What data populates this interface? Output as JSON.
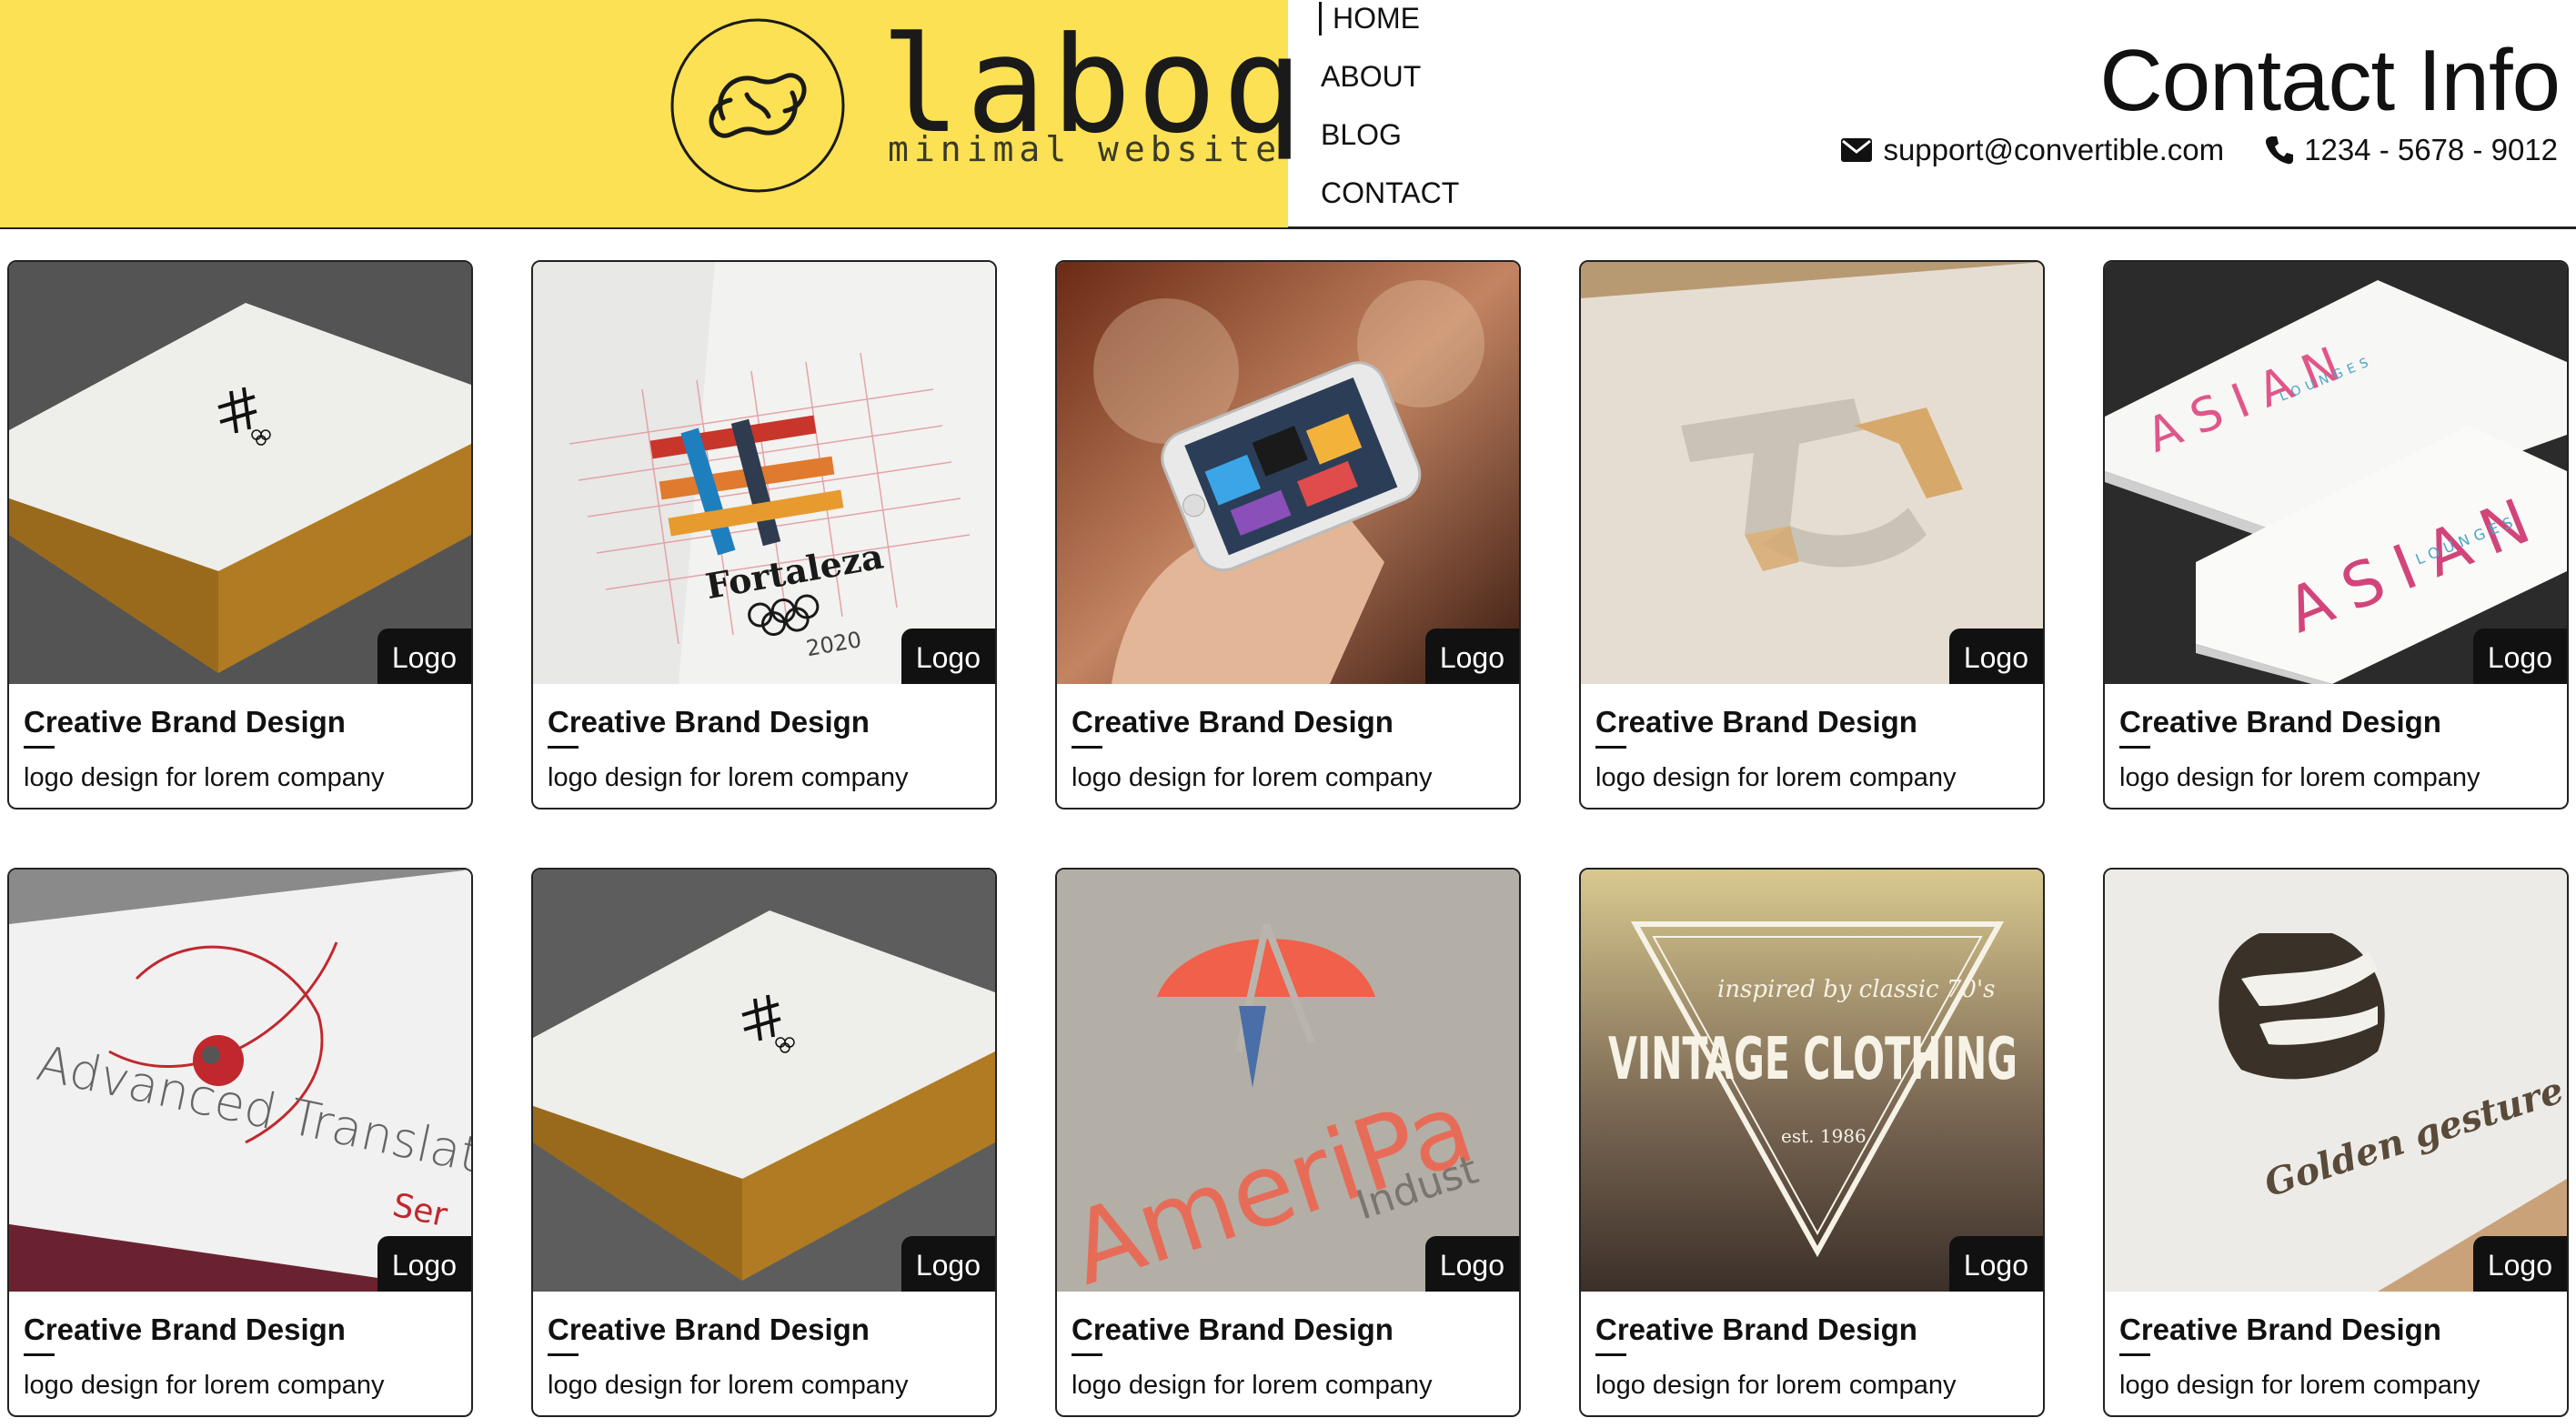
{
  "brand": {
    "wordmark": "laboq",
    "tagline": "minimal website",
    "background": "#fbe153"
  },
  "nav": {
    "items": [
      {
        "label": "HOME",
        "active": true
      },
      {
        "label": "ABOUT",
        "active": false
      },
      {
        "label": "BLOG",
        "active": false
      },
      {
        "label": "CONTACT",
        "active": false
      }
    ]
  },
  "contact": {
    "title": "Contact Info",
    "email": "support@convertible.com",
    "phone": "1234 - 5678 - 9012",
    "email_icon": "envelope-icon",
    "phone_icon": "phone-icon"
  },
  "portfolio": {
    "items": [
      {
        "tag": "Logo",
        "title": "Creative Brand Design",
        "desc": "logo design for lorem company",
        "image": "book-cover-hash-logo"
      },
      {
        "tag": "Logo",
        "title": "Creative Brand Design",
        "desc": "logo design for lorem company",
        "image": "fortaleza-grid-sketch"
      },
      {
        "tag": "Logo",
        "title": "Creative Brand Design",
        "desc": "logo design for lorem company",
        "image": "phone-in-hand"
      },
      {
        "tag": "Logo",
        "title": "Creative Brand Design",
        "desc": "logo design for lorem company",
        "image": "embossed-js-logo"
      },
      {
        "tag": "Logo",
        "title": "Creative Brand Design",
        "desc": "logo design for lorem company",
        "image": "asian-lounges-cards"
      },
      {
        "tag": "Logo",
        "title": "Creative Brand Design",
        "desc": "logo design for lorem company",
        "image": "advanced-translation-card"
      },
      {
        "tag": "Logo",
        "title": "Creative Brand Design",
        "desc": "logo design for lorem company",
        "image": "book-cover-hash-logo"
      },
      {
        "tag": "Logo",
        "title": "Creative Brand Design",
        "desc": "logo design for lorem company",
        "image": "ameripa-embossed"
      },
      {
        "tag": "Logo",
        "title": "Creative Brand Design",
        "desc": "logo design for lorem company",
        "image": "vintage-clothing-badge"
      },
      {
        "tag": "Logo",
        "title": "Creative Brand Design",
        "desc": "logo design for lorem company",
        "image": "golden-gesture-card"
      }
    ],
    "artwork_text": {
      "fortaleza": "Fortaleza",
      "fortaleza_year": "2020",
      "asian": "ASIAN",
      "lounges": "LOUNGES",
      "translation": "Advanced Translat",
      "translation_sub": "Ser",
      "ameripa": "AmeriPa",
      "ameripa_sub": "Indust",
      "vintage_top": "inspired by classic 70's",
      "vintage_main": "VINTAGE CLOTHING",
      "vintage_est": "est. 1986",
      "golden": "Golden gesture"
    }
  }
}
